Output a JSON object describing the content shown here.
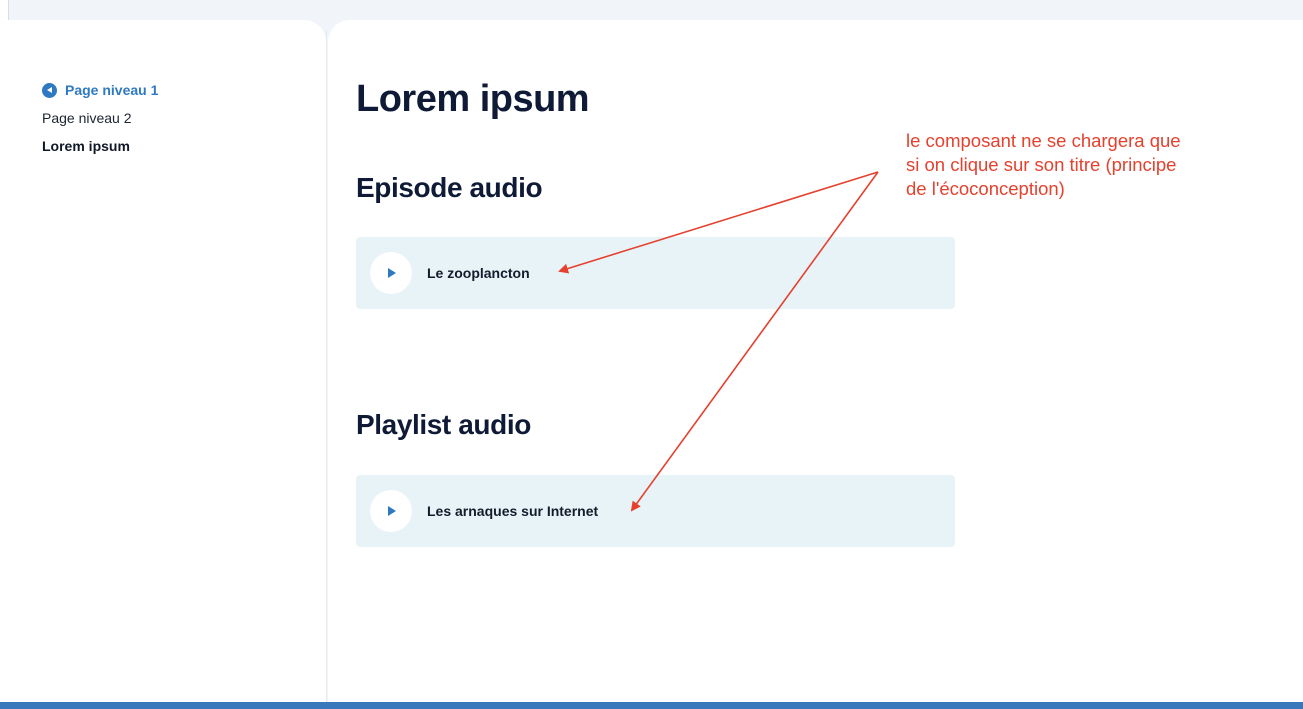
{
  "sidebar": {
    "back_label": "Page niveau 1",
    "items": [
      {
        "label": "Page niveau 2",
        "current": false
      },
      {
        "label": "Lorem ipsum",
        "current": true
      }
    ]
  },
  "main": {
    "title": "Lorem ipsum",
    "sections": [
      {
        "heading": "Episode audio",
        "item_title": "Le zooplancton"
      },
      {
        "heading": "Playlist audio",
        "item_title": "Les arnaques sur Internet"
      }
    ]
  },
  "annotation": {
    "lines": [
      "le composant ne se chargera que",
      "si on clique sur son titre (principe",
      "de l'écoconception)"
    ]
  },
  "icons": {
    "back": "chevron-left-circle-icon",
    "play": "play-icon"
  },
  "colors": {
    "accent": "#2f79c2",
    "annotation": "#e5412e",
    "card_background": "#e8f3f8",
    "bottom_bar": "#3977bd",
    "heading": "#0f1b36"
  }
}
